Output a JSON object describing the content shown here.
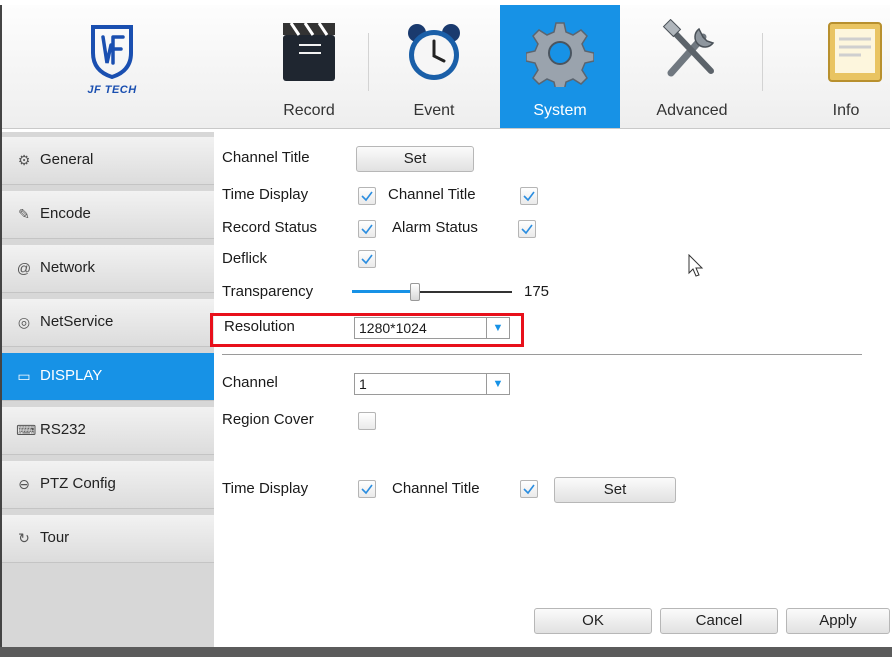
{
  "brand": {
    "logo_text": "JF TECH"
  },
  "tabs": [
    {
      "label": "Record",
      "icon": "clapperboard-icon"
    },
    {
      "label": "Event",
      "icon": "alarm-clock-icon"
    },
    {
      "label": "System",
      "icon": "gear-icon",
      "active": true
    },
    {
      "label": "Advanced",
      "icon": "tools-icon"
    },
    {
      "label": "Info",
      "icon": "info-panel-icon"
    }
  ],
  "sidebar": {
    "items": [
      {
        "label": "General",
        "icon": "gear-small-icon"
      },
      {
        "label": "Encode",
        "icon": "edit-icon"
      },
      {
        "label": "Network",
        "icon": "at-icon"
      },
      {
        "label": "NetService",
        "icon": "globe-icon"
      },
      {
        "label": "DISPLAY",
        "icon": "monitor-icon",
        "active": true
      },
      {
        "label": "RS232",
        "icon": "keyboard-icon"
      },
      {
        "label": "PTZ Config",
        "icon": "ptz-icon"
      },
      {
        "label": "Tour",
        "icon": "tour-icon"
      }
    ]
  },
  "display": {
    "channel_title_label": "Channel Title",
    "set_label": "Set",
    "time_display_label": "Time Display",
    "time_display_checked": true,
    "channel_title_checked": true,
    "record_status_label": "Record Status",
    "record_status_checked": true,
    "alarm_status_label": "Alarm Status",
    "alarm_status_checked": true,
    "deflick_label": "Deflick",
    "deflick_checked": true,
    "transparency_label": "Transparency",
    "transparency_value": "175",
    "resolution_label": "Resolution",
    "resolution_value": "1280*1024",
    "channel_label": "Channel",
    "channel_value": "1",
    "region_cover_label": "Region Cover",
    "region_cover_checked": false,
    "ch_time_display_label": "Time Display",
    "ch_channel_title_label": "Channel Title",
    "ch_set_label": "Set"
  },
  "footer": {
    "ok_label": "OK",
    "cancel_label": "Cancel",
    "apply_label": "Apply"
  },
  "colors": {
    "accent": "#1792e6",
    "highlight": "#e8101b"
  }
}
